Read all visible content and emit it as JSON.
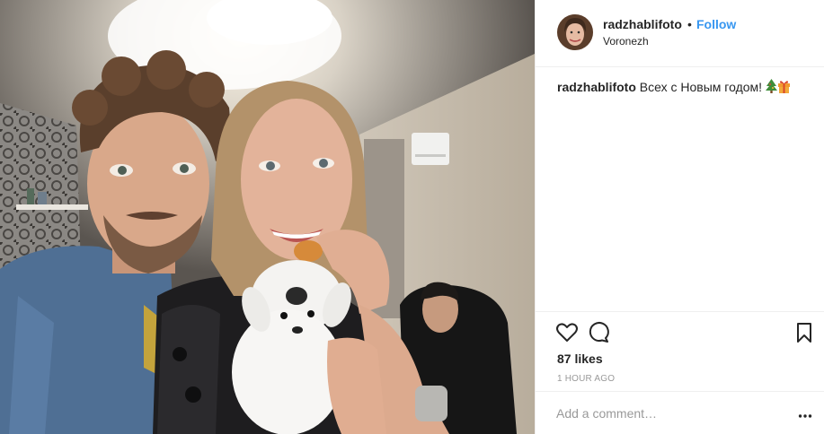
{
  "post": {
    "username": "radzhablifoto",
    "separator": "•",
    "follow_label": "Follow",
    "location": "Voronezh",
    "caption_username": "radzhablifoto",
    "caption_text": "Всех с Новым годом!",
    "caption_emojis": [
      "christmas-tree-icon",
      "gift-icon"
    ],
    "likes": "87 likes",
    "timestamp": "1 HOUR AGO",
    "comment_placeholder": "Add a comment…"
  },
  "photo": {
    "description_icon": "selfie-photo"
  },
  "colors": {
    "link": "#3897f0",
    "text": "#262626",
    "muted": "#999999",
    "divider": "#efefef"
  },
  "icons": [
    "heart-icon",
    "comment-icon",
    "bookmark-icon",
    "more-options-icon"
  ]
}
